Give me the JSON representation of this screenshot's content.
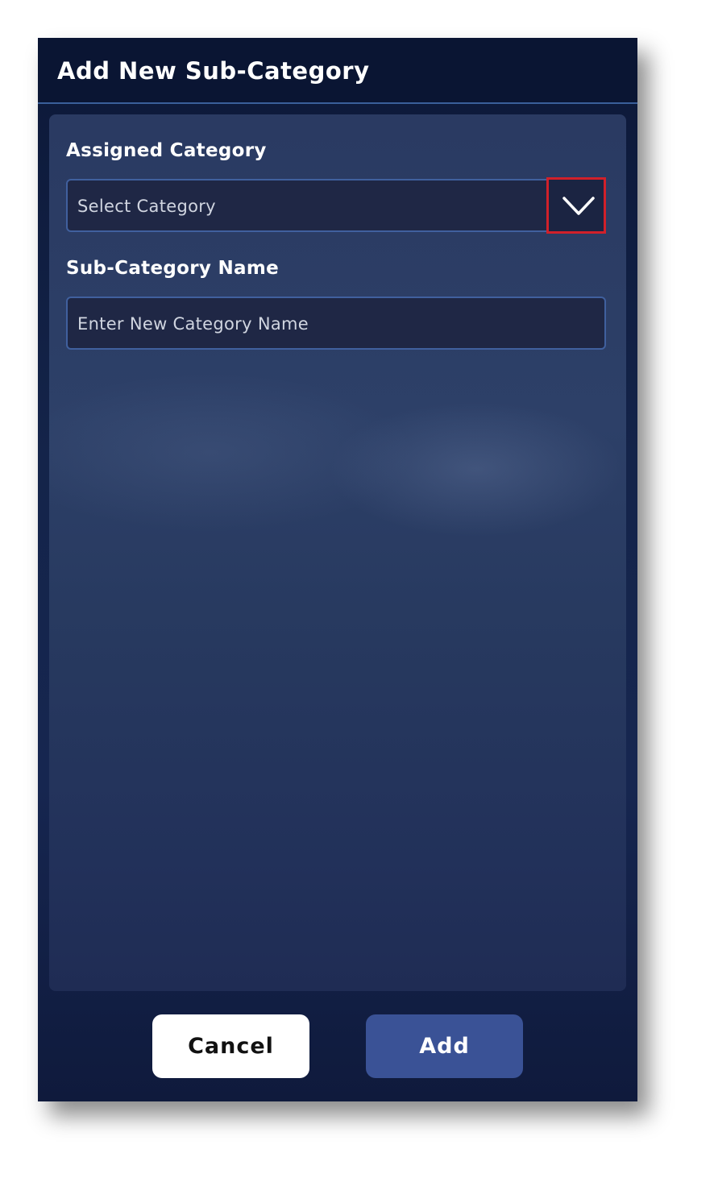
{
  "dialog": {
    "title": "Add New Sub-Category"
  },
  "form": {
    "assigned_category": {
      "label": "Assigned Category",
      "placeholder": "Select Category",
      "icon": "chevron-down-icon"
    },
    "sub_category_name": {
      "label": "Sub-Category Name",
      "placeholder": "Enter New Category Name"
    }
  },
  "actions": {
    "cancel_label": "Cancel",
    "add_label": "Add"
  },
  "colors": {
    "highlight": "#d1202a",
    "primary_button": "#3a5296"
  }
}
